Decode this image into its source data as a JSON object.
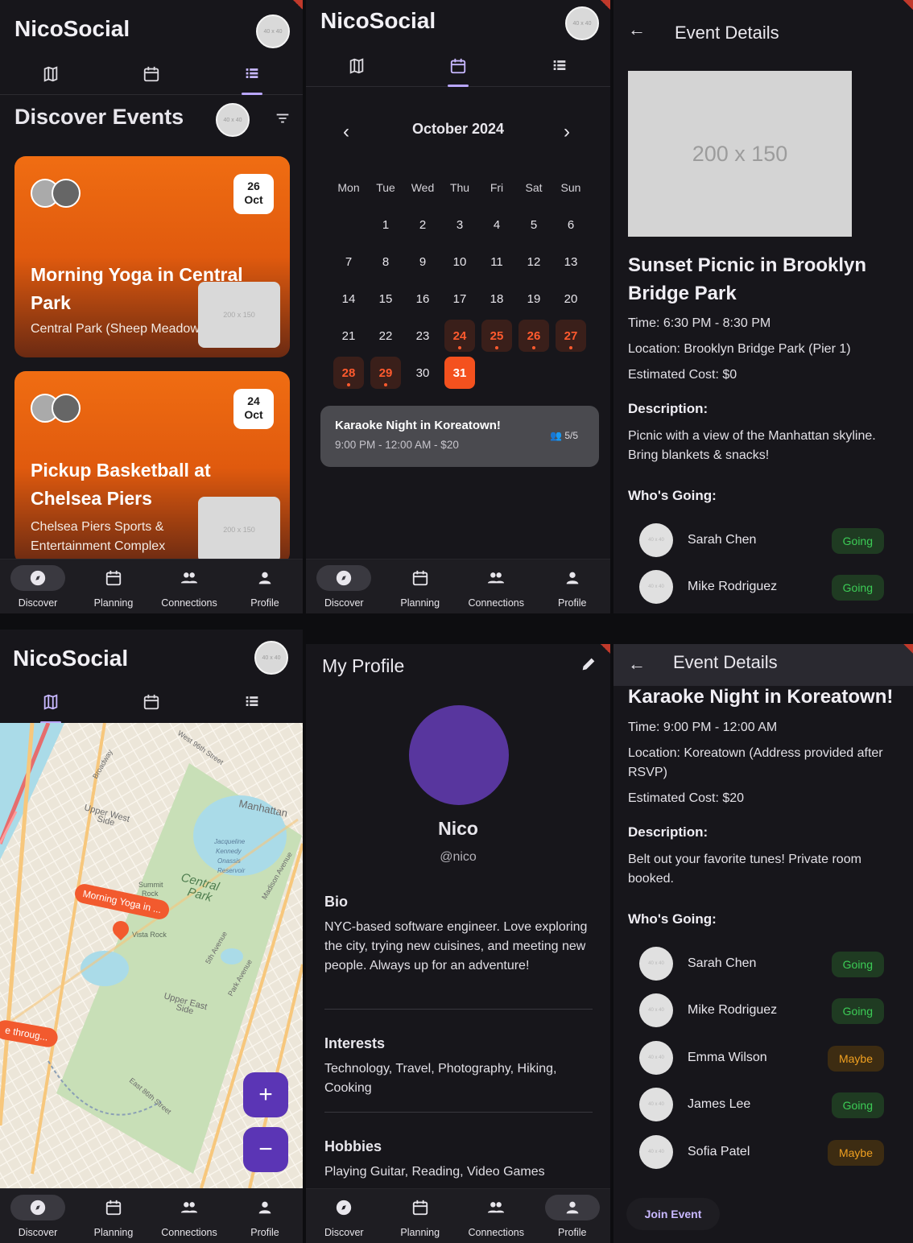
{
  "app": {
    "title": "NicoSocial",
    "avatar_placeholder": "40 x 40"
  },
  "bottom_nav": [
    {
      "label": "Discover",
      "icon": "compass-icon"
    },
    {
      "label": "Planning",
      "icon": "calendar-icon"
    },
    {
      "label": "Connections",
      "icon": "people-icon"
    },
    {
      "label": "Profile",
      "icon": "person-icon"
    }
  ],
  "discover": {
    "heading": "Discover Events",
    "cards": [
      {
        "day": "26",
        "month": "Oct",
        "title": "Morning Yoga in Central Park",
        "location": "Central Park (Sheep Meadow)",
        "thumb": "200 x 150"
      },
      {
        "day": "24",
        "month": "Oct",
        "title": "Pickup Basketball at Chelsea Piers",
        "location": "Chelsea Piers Sports & Entertainment Complex",
        "thumb": "200 x 150"
      }
    ]
  },
  "calendar": {
    "month": "October 2024",
    "weekdays": [
      "Mon",
      "Tue",
      "Wed",
      "Thu",
      "Fri",
      "Sat",
      "Sun"
    ],
    "highlighted_days": [
      24,
      25,
      26,
      27,
      28,
      29
    ],
    "today": 31,
    "event": {
      "title": "Karaoke Night in Koreatown!",
      "subtitle": "9:00 PM - 12:00 AM - $20",
      "count": "5/5"
    }
  },
  "event1": {
    "header": "Event Details",
    "image_placeholder": "200 x 150",
    "title": "Sunset Picnic in Brooklyn Bridge Park",
    "time": "Time: 6:30 PM - 8:30 PM",
    "location": "Location: Brooklyn Bridge Park (Pier 1)",
    "cost": "Estimated Cost: $0",
    "description_label": "Description:",
    "description": "Picnic with a view of the Manhattan skyline. Bring blankets & snacks!",
    "going_label": "Who's Going:",
    "attendees": [
      {
        "name": "Sarah Chen",
        "status": "Going"
      },
      {
        "name": "Mike Rodriguez",
        "status": "Going"
      }
    ]
  },
  "map": {
    "labels": [
      "Upper West Side",
      "Manhattan",
      "Central Park",
      "Upper East Side",
      "Morning Yoga in ...",
      "e throug...",
      "Summit Rock",
      "Vista Rock",
      "Jacqueline Kennedy Onassis Reservoir",
      "West 96th Street",
      "Broadway",
      "5th Avenue",
      "Park Avenue",
      "Madison Avenue",
      "East 86th Street"
    ]
  },
  "profile": {
    "header": "My Profile",
    "name": "Nico",
    "handle": "@nico",
    "bio_label": "Bio",
    "bio": "NYC-based software engineer. Love exploring the city, trying new cuisines, and meeting new people. Always up for an adventure!",
    "interests_label": "Interests",
    "interests": "Technology, Travel, Photography, Hiking, Cooking",
    "hobbies_label": "Hobbies",
    "hobbies": "Playing Guitar, Reading, Video Games"
  },
  "event2": {
    "header": "Event Details",
    "title": "Karaoke Night in Koreatown!",
    "time": "Time: 9:00 PM - 12:00 AM",
    "location": "Location: Koreatown (Address provided after RSVP)",
    "cost": "Estimated Cost: $20",
    "description_label": "Description:",
    "description": "Belt out your favorite tunes! Private room booked.",
    "going_label": "Who's Going:",
    "attendees": [
      {
        "name": "Sarah Chen",
        "status": "Going"
      },
      {
        "name": "Mike Rodriguez",
        "status": "Going"
      },
      {
        "name": "Emma Wilson",
        "status": "Maybe"
      },
      {
        "name": "James Lee",
        "status": "Going"
      },
      {
        "name": "Sofia Patel",
        "status": "Maybe"
      }
    ],
    "join_label": "Join Event"
  },
  "colors": {
    "accent": "#5b35b5",
    "orange": "#f4511e",
    "going": "#3ccc56",
    "maybe": "#f0a020"
  }
}
